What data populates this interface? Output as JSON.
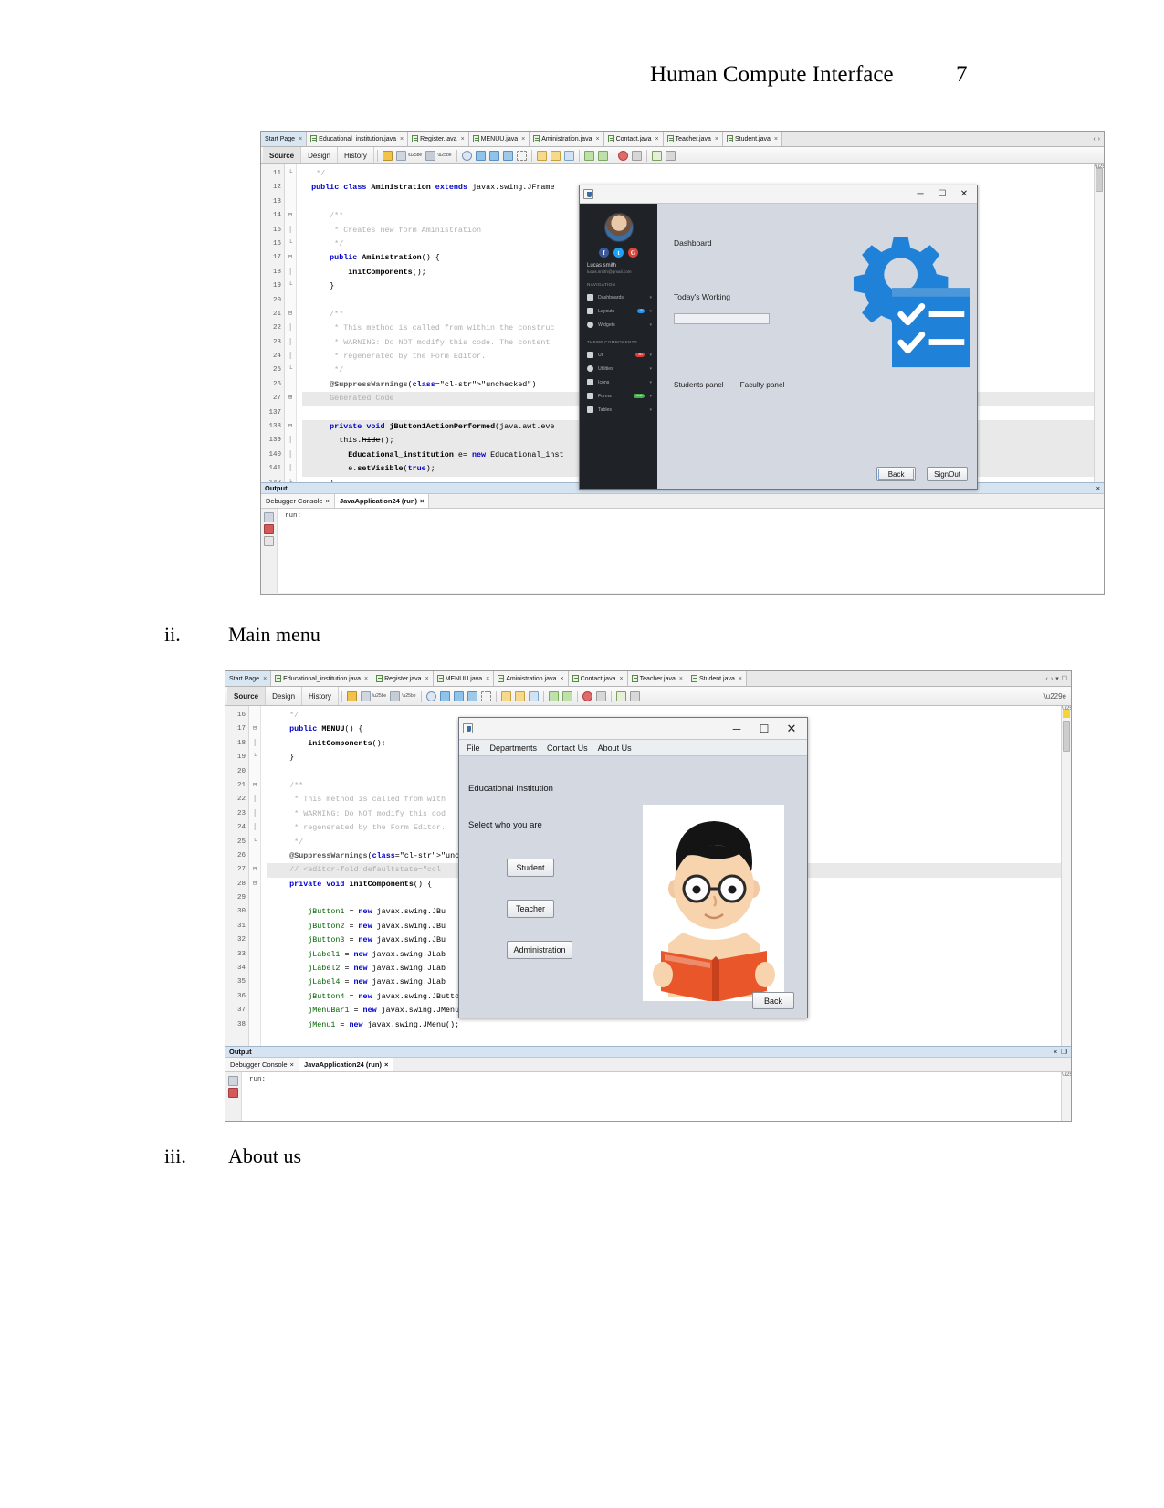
{
  "page": {
    "header_title": "Human Compute Interface",
    "page_number": "7"
  },
  "captions": [
    {
      "numeral": "ii.",
      "text": "Main menu"
    },
    {
      "numeral": "iii.",
      "text": "About us"
    }
  ],
  "screenshot_admin": {
    "tabs": [
      {
        "label": "Start Page",
        "active": true,
        "has_file_icon": false,
        "close": "×"
      },
      {
        "label": "Educational_institution.java",
        "active": false,
        "has_file_icon": true,
        "close": "×"
      },
      {
        "label": "Register.java",
        "active": false,
        "has_file_icon": true,
        "close": "×"
      },
      {
        "label": "MENUU.java",
        "active": false,
        "has_file_icon": true,
        "close": "×"
      },
      {
        "label": "Aministration.java",
        "active": false,
        "has_file_icon": true,
        "close": "×"
      },
      {
        "label": "Contact.java",
        "active": false,
        "has_file_icon": true,
        "close": "×"
      },
      {
        "label": "Teacher.java",
        "active": false,
        "has_file_icon": true,
        "close": "×"
      },
      {
        "label": "Student.java",
        "active": false,
        "has_file_icon": true,
        "close": "×"
      }
    ],
    "tabstrip_right": [
      "‹",
      "›"
    ],
    "view_tabs": [
      {
        "label": "Source",
        "selected": true
      },
      {
        "label": "Design",
        "selected": false
      },
      {
        "label": "History",
        "selected": false
      }
    ],
    "code_lines": [
      {
        "num": "11",
        "fold": "└",
        "text": "   */"
      },
      {
        "num": "12",
        "fold": "",
        "text": "  public class Aministration extends javax.swing.JFrame"
      },
      {
        "num": "13",
        "fold": "",
        "text": ""
      },
      {
        "num": "14",
        "fold": "⊟",
        "text": "      /**"
      },
      {
        "num": "15",
        "fold": "│",
        "text": "       * Creates new form Aministration"
      },
      {
        "num": "16",
        "fold": "└",
        "text": "       */"
      },
      {
        "num": "17",
        "fold": "⊟",
        "text": "      public Aministration() {"
      },
      {
        "num": "18",
        "fold": "│",
        "text": "          initComponents();"
      },
      {
        "num": "19",
        "fold": "└",
        "text": "      }"
      },
      {
        "num": "20",
        "fold": "",
        "text": ""
      },
      {
        "num": "21",
        "fold": "⊟",
        "text": "      /**"
      },
      {
        "num": "22",
        "fold": "│",
        "text": "       * This method is called from within the construc"
      },
      {
        "num": "23",
        "fold": "│",
        "text": "       * WARNING: Do NOT modify this code. The content "
      },
      {
        "num": "24",
        "fold": "│",
        "text": "       * regenerated by the Form Editor."
      },
      {
        "num": "25",
        "fold": "└",
        "text": "       */"
      },
      {
        "num": "26",
        "fold": "",
        "text": "      @SuppressWarnings(\"unchecked\")"
      },
      {
        "num": "27",
        "fold": "⊞",
        "text": "      Generated Code"
      },
      {
        "num": "137",
        "fold": "",
        "text": ""
      },
      {
        "num": "138",
        "fold": "⊟",
        "text": "      private void jButton1ActionPerformed(java.awt.eve"
      },
      {
        "num": "139",
        "fold": "│",
        "text": "        this.hide();"
      },
      {
        "num": "140",
        "fold": "│",
        "text": "          Educational_institution e= new Educational_inst"
      },
      {
        "num": "141",
        "fold": "│",
        "text": "          e.setVisible(true);"
      },
      {
        "num": "142",
        "fold": "└",
        "text": "      }"
      }
    ],
    "output": {
      "title": "Output",
      "close_glyph": "×",
      "tabs": [
        {
          "label": "Debugger Console",
          "active": false,
          "close": "×"
        },
        {
          "label": "JavaApplication24 (run)",
          "active": true,
          "close": "×"
        }
      ],
      "body_text": "run:"
    },
    "dialog": {
      "window_buttons": {
        "minimize": "─",
        "maximize": "☐",
        "close": "✕"
      },
      "sidebar": {
        "user_name": "Lucas smith",
        "user_email": "lucas.smith@gmail.com",
        "user_caret": "▾",
        "socials": [
          {
            "name": "facebook-icon",
            "glyph": "f",
            "color": "#3b5998"
          },
          {
            "name": "twitter-icon",
            "glyph": "t",
            "color": "#1da1f2"
          },
          {
            "name": "google-plus-icon",
            "glyph": "G",
            "color": "#db4437"
          }
        ],
        "sections": [
          {
            "title": "NAVIGATION",
            "items": [
              {
                "label": "Dashboards",
                "icon": "grid-icon",
                "badge": null,
                "caret": "▾"
              },
              {
                "label": "Layouts",
                "icon": "layout-icon",
                "badge": {
                  "text": "9",
                  "color": "#2196f3"
                },
                "caret": "▾"
              },
              {
                "label": "Widgets",
                "icon": "widget-icon",
                "badge": null,
                "caret": "▾"
              }
            ]
          },
          {
            "title": "THEME COMPONENTS",
            "items": [
              {
                "label": "UI",
                "icon": "bell-icon",
                "badge": {
                  "text": "80",
                  "color": "#e53935"
                },
                "caret": "▾"
              },
              {
                "label": "Utilities",
                "icon": "gear-icon",
                "badge": null,
                "caret": "▾"
              },
              {
                "label": "Icons",
                "icon": "flag-icon",
                "badge": null,
                "caret": "▾"
              },
              {
                "label": "Forms",
                "icon": "form-icon",
                "badge": {
                  "text": "new",
                  "color": "#4caf50"
                },
                "caret": "▾"
              },
              {
                "label": "Tables",
                "icon": "table-icon",
                "badge": null,
                "caret": "▾"
              }
            ]
          }
        ]
      },
      "content": {
        "heading": "Dashboard",
        "subheading": "Today's Working",
        "input_value": "",
        "links": [
          "Students panel",
          "Faculty panel"
        ],
        "buttons": [
          {
            "label": "Back",
            "name": "back-button"
          },
          {
            "label": "SignOut",
            "name": "signout-button"
          }
        ],
        "art_colors": {
          "gear": "#1f82d8",
          "checklist": "#1f82d8",
          "check": "#ffffff"
        }
      }
    }
  },
  "screenshot_menu": {
    "tabs": [
      {
        "label": "Start Page",
        "active": true,
        "has_file_icon": false,
        "close": "×"
      },
      {
        "label": "Educational_institution.java",
        "active": false,
        "has_file_icon": true,
        "close": "×"
      },
      {
        "label": "Register.java",
        "active": false,
        "has_file_icon": true,
        "close": "×"
      },
      {
        "label": "MENUU.java",
        "active": false,
        "has_file_icon": true,
        "close": "×"
      },
      {
        "label": "Aministration.java",
        "active": false,
        "has_file_icon": true,
        "close": "×"
      },
      {
        "label": "Contact.java",
        "active": false,
        "has_file_icon": true,
        "close": "×"
      },
      {
        "label": "Teacher.java",
        "active": false,
        "has_file_icon": true,
        "close": "×"
      },
      {
        "label": "Student.java",
        "active": false,
        "has_file_icon": true,
        "close": "×"
      }
    ],
    "tabstrip_right": [
      "‹",
      "›",
      "▾",
      "☐"
    ],
    "view_tabs": [
      {
        "label": "Source",
        "selected": true
      },
      {
        "label": "Design",
        "selected": false
      },
      {
        "label": "History",
        "selected": false
      }
    ],
    "code_lines": [
      {
        "num": "16",
        "fold": "",
        "text": "     */"
      },
      {
        "num": "17",
        "fold": "⊟",
        "text": "     public MENUU() {"
      },
      {
        "num": "18",
        "fold": "│",
        "text": "         initComponents();"
      },
      {
        "num": "19",
        "fold": "└",
        "text": "     }"
      },
      {
        "num": "20",
        "fold": "",
        "text": ""
      },
      {
        "num": "21",
        "fold": "⊟",
        "text": "     /**"
      },
      {
        "num": "22",
        "fold": "│",
        "text": "      * This method is called from with"
      },
      {
        "num": "23",
        "fold": "│",
        "text": "      * WARNING: Do NOT modify this cod"
      },
      {
        "num": "24",
        "fold": "│",
        "text": "      * regenerated by the Form Editor."
      },
      {
        "num": "25",
        "fold": "└",
        "text": "      */"
      },
      {
        "num": "26",
        "fold": "",
        "text": "     @SuppressWarnings(\"unchecked\")"
      },
      {
        "num": "27",
        "fold": "⊟",
        "text": "     // <editor-fold defaultstate=\"col"
      },
      {
        "num": "28",
        "fold": "⊟",
        "text": "     private void initComponents() {"
      },
      {
        "num": "29",
        "fold": "",
        "text": ""
      },
      {
        "num": "30",
        "fold": "",
        "text": "         jButton1 = new javax.swing.JBu"
      },
      {
        "num": "31",
        "fold": "",
        "text": "         jButton2 = new javax.swing.JBu"
      },
      {
        "num": "32",
        "fold": "",
        "text": "         jButton3 = new javax.swing.JBu"
      },
      {
        "num": "33",
        "fold": "",
        "text": "         jLabel1 = new javax.swing.JLab"
      },
      {
        "num": "34",
        "fold": "",
        "text": "         jLabel2 = new javax.swing.JLab"
      },
      {
        "num": "35",
        "fold": "",
        "text": "         jLabel4 = new javax.swing.JLab"
      },
      {
        "num": "36",
        "fold": "",
        "text": "         jButton4 = new javax.swing.JButton();"
      },
      {
        "num": "37",
        "fold": "",
        "text": "         jMenuBar1 = new javax.swing.JMenuBar();"
      },
      {
        "num": "38",
        "fold": "",
        "text": "         jMenu1 = new javax.swing.JMenu();"
      }
    ],
    "output": {
      "title": "Output",
      "close_glyph": "×",
      "float_glyph": "❐",
      "tabs": [
        {
          "label": "Debugger Console",
          "active": false,
          "close": "×"
        },
        {
          "label": "JavaApplication24 (run)",
          "active": true,
          "close": "×"
        }
      ],
      "body_text": "run:"
    },
    "dialog": {
      "window_buttons": {
        "minimize": "─",
        "maximize": "☐",
        "close": "✕"
      },
      "menubar": [
        "File",
        "Departments",
        "Contact Us",
        "About Us"
      ],
      "title": "Educational Institution",
      "subtitle": "Select who you are",
      "buttons": [
        {
          "label": "Student",
          "name": "student-button"
        },
        {
          "label": "Teacher",
          "name": "teacher-button"
        },
        {
          "label": "Administration",
          "name": "administration-button"
        }
      ],
      "back_button": "Back",
      "illustration": "student-reading-book-illustration"
    }
  }
}
